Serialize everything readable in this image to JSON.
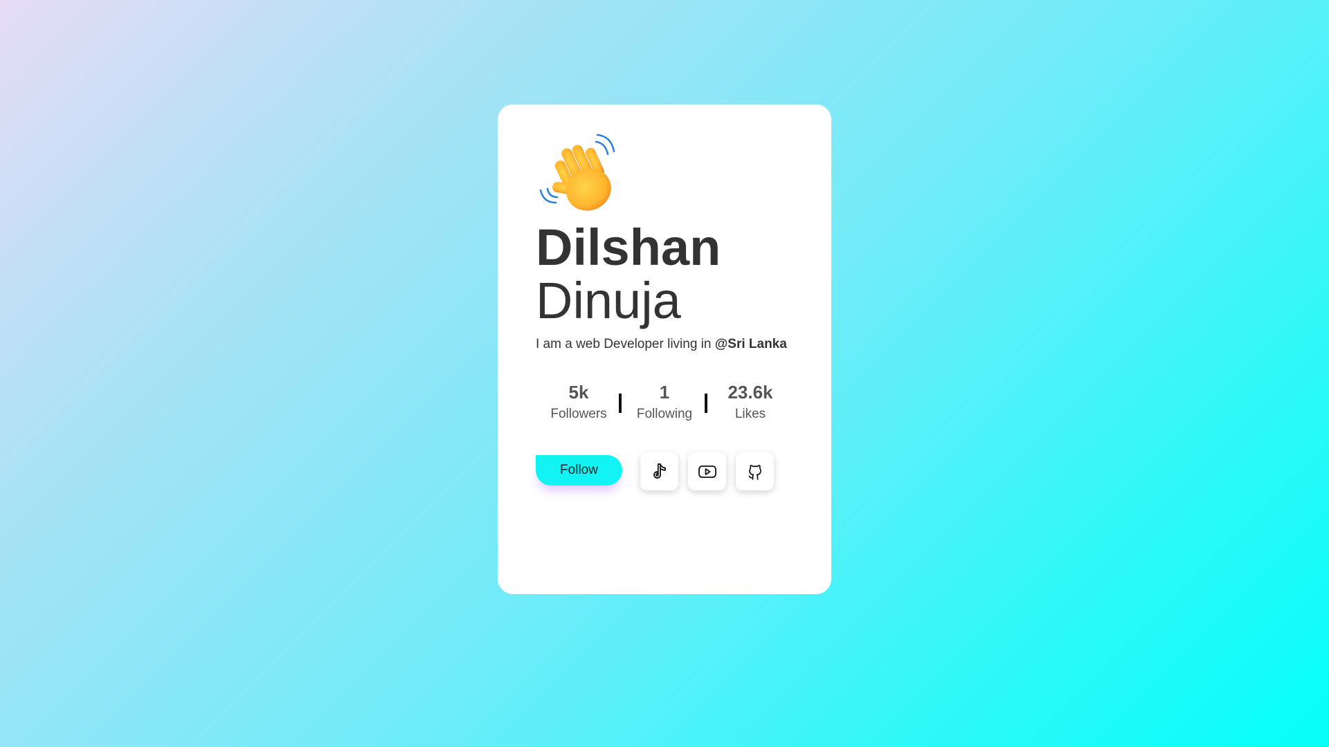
{
  "profile": {
    "first_name": "Dilshan",
    "last_name": "Dinuja",
    "bio_prefix": "I am a web Developer living in ",
    "bio_location": "@Sri Lanka",
    "avatar_icon": "waving-hand-icon"
  },
  "stats": [
    {
      "value": "5k",
      "label": "Followers"
    },
    {
      "value": "1",
      "label": "Following"
    },
    {
      "value": "23.6k",
      "label": "Likes"
    }
  ],
  "actions": {
    "follow_label": "Follow",
    "social": [
      {
        "icon": "tiktok-icon"
      },
      {
        "icon": "youtube-icon"
      },
      {
        "icon": "github-icon"
      }
    ]
  },
  "colors": {
    "accent": "#12f4f4",
    "text": "#333333",
    "card": "#ffffff"
  }
}
